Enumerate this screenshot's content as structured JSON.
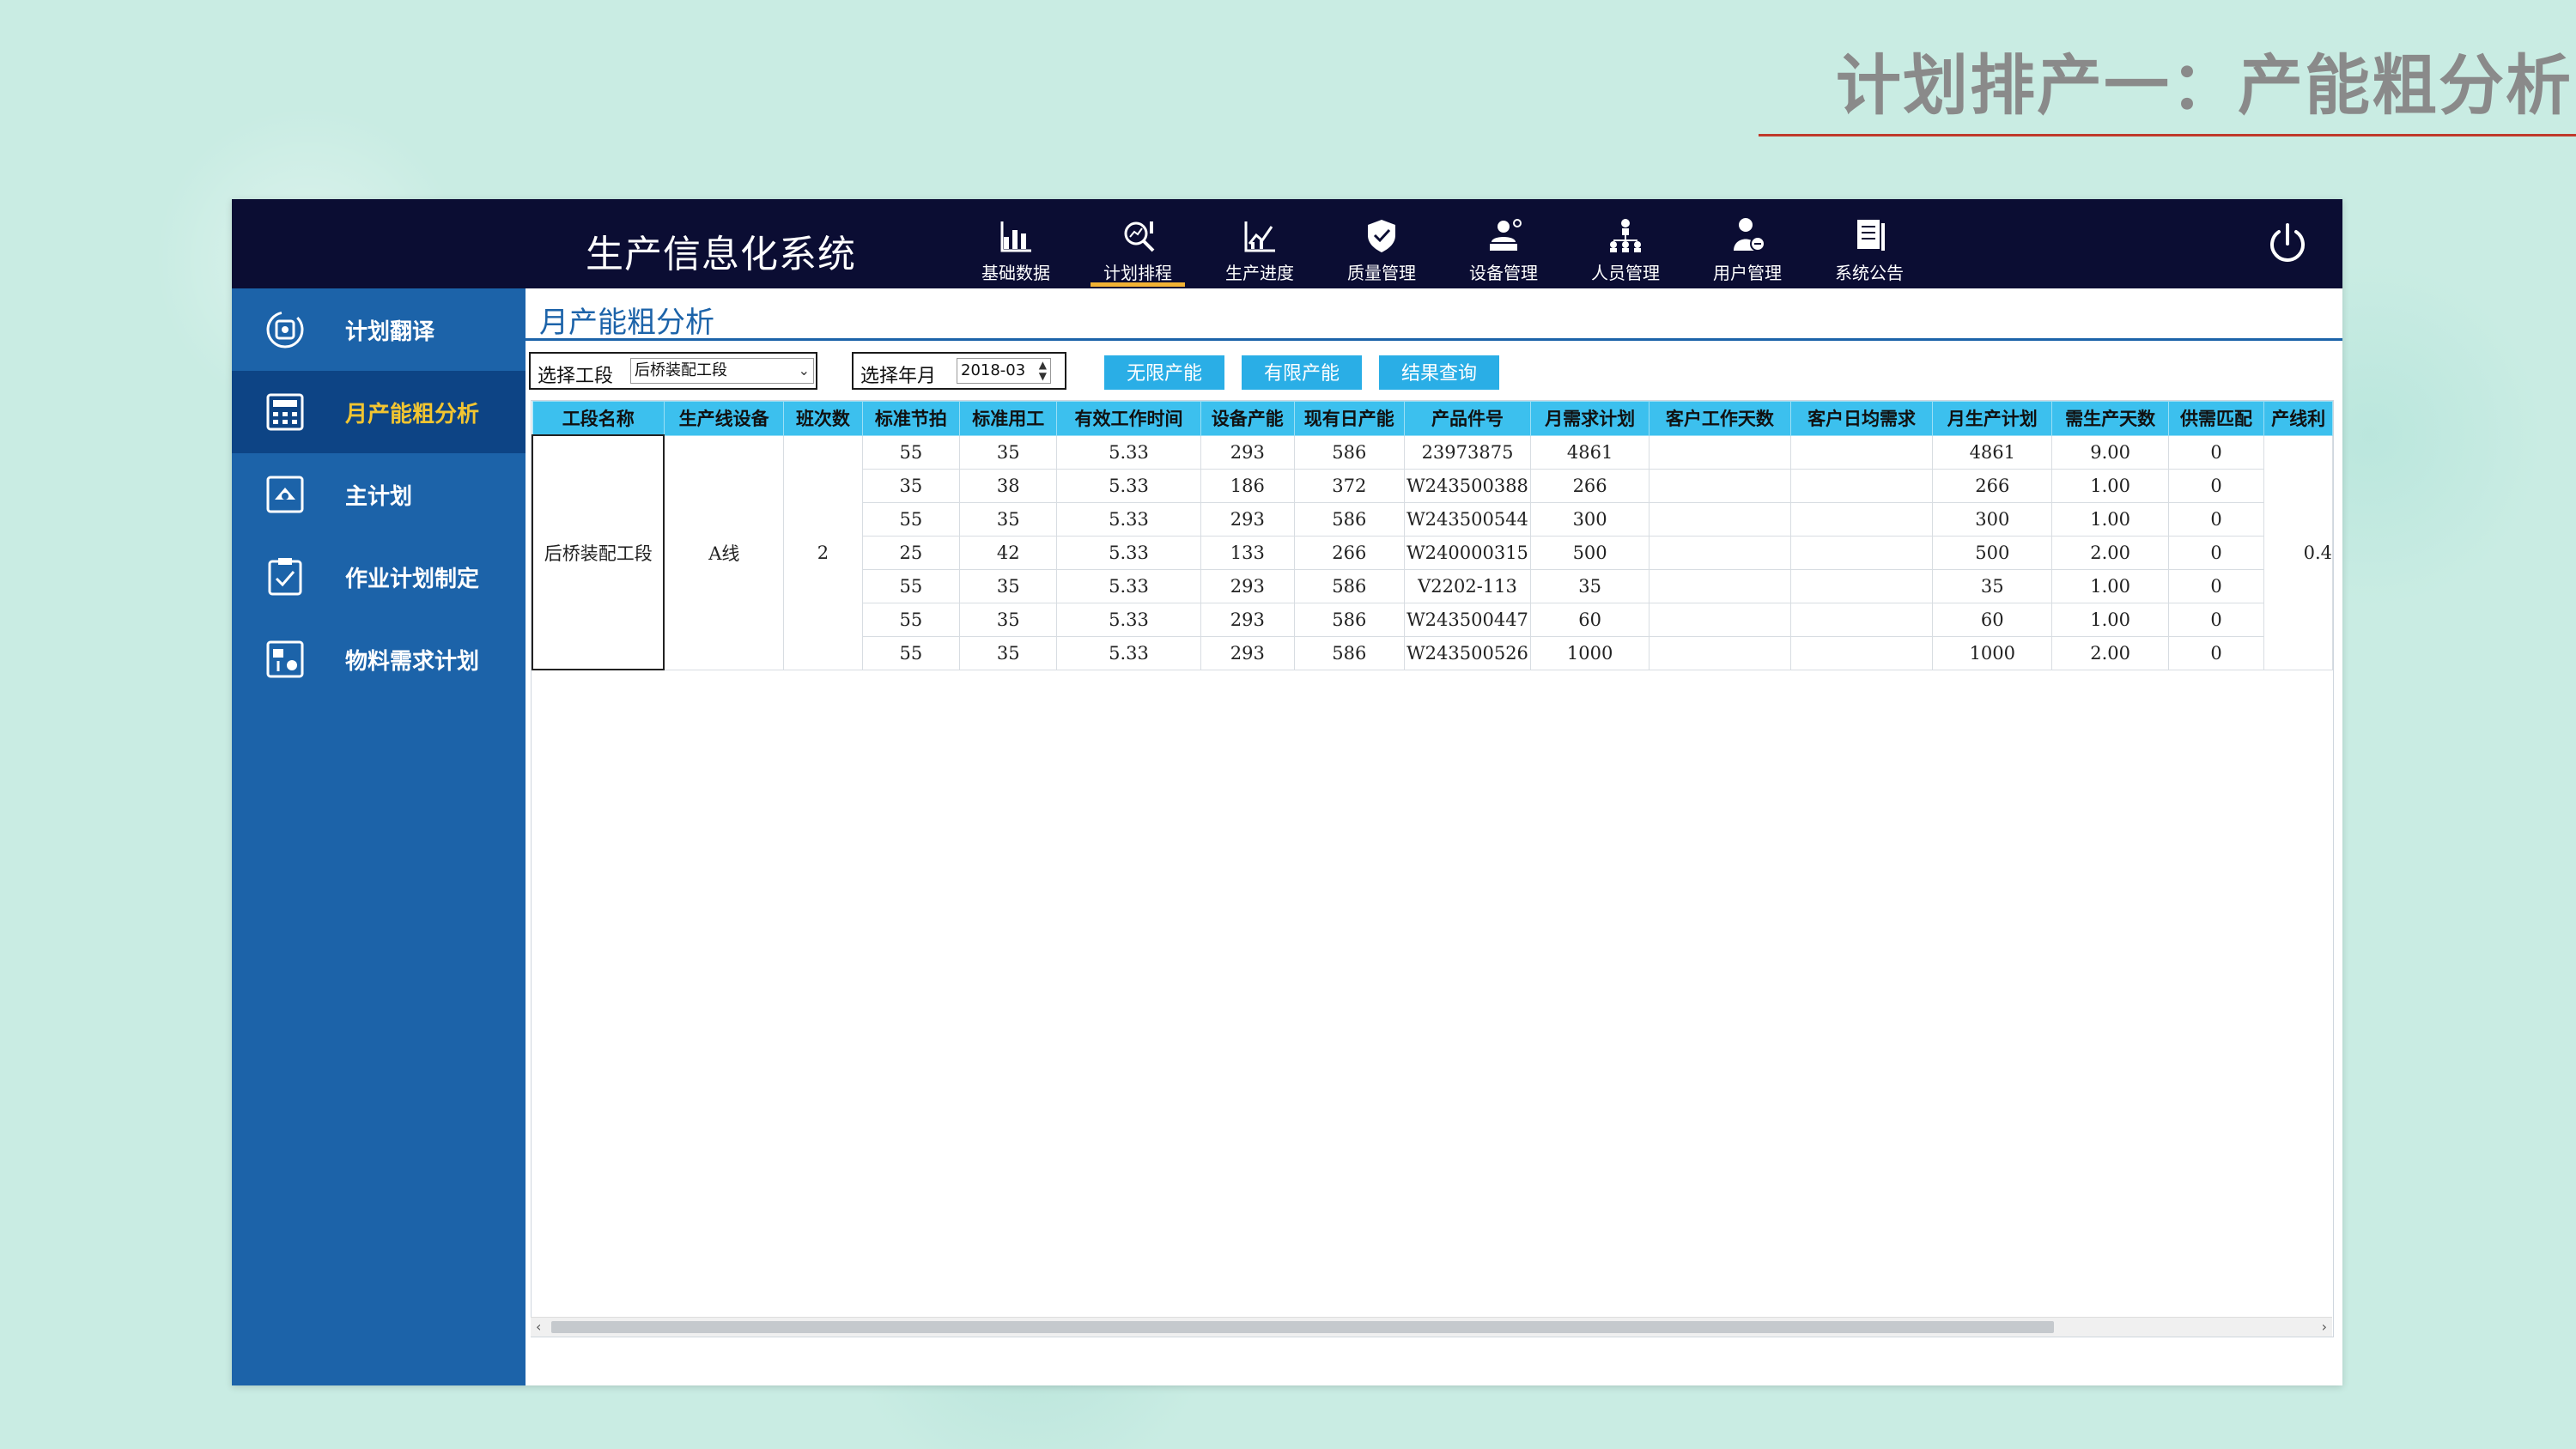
{
  "slide": {
    "title": "计划排产一：产能粗分析"
  },
  "topbar": {
    "system_title": "生产信息化系统",
    "nav": [
      {
        "label": "基础数据",
        "icon": "bar-chart-icon"
      },
      {
        "label": "计划排程",
        "icon": "search-analytics-icon",
        "active": true
      },
      {
        "label": "生产进度",
        "icon": "line-chart-icon"
      },
      {
        "label": "质量管理",
        "icon": "shield-check-icon"
      },
      {
        "label": "设备管理",
        "icon": "device-user-icon"
      },
      {
        "label": "人员管理",
        "icon": "org-chart-icon"
      },
      {
        "label": "用户管理",
        "icon": "user-icon"
      },
      {
        "label": "系统公告",
        "icon": "notice-icon"
      }
    ],
    "power_icon": "power-icon"
  },
  "sidebar": {
    "items": [
      {
        "label": "计划翻译",
        "icon": "translate-icon"
      },
      {
        "label": "月产能粗分析",
        "icon": "calculator-icon",
        "active": true
      },
      {
        "label": "主计划",
        "icon": "plan-icon"
      },
      {
        "label": "作业计划制定",
        "icon": "clipboard-check-icon"
      },
      {
        "label": "物料需求计划",
        "icon": "material-icon"
      }
    ]
  },
  "main": {
    "page_title": "月产能粗分析",
    "filters": {
      "section_label": "选择工段",
      "section_value": "后桥装配工段",
      "month_label": "选择年月",
      "month_value": "2018-03"
    },
    "buttons": {
      "unlimited": "无限产能",
      "limited": "有限产能",
      "query": "结果查询"
    },
    "table": {
      "columns": [
        "工段名称",
        "生产线设备",
        "班次数",
        "标准节拍",
        "标准用工",
        "有效工作时间",
        "设备产能",
        "现有日产能",
        "产品件号",
        "月需求计划",
        "客户工作天数",
        "客户日均需求",
        "月生产计划",
        "需生产天数",
        "供需匹配",
        "产线利"
      ],
      "merged": {
        "section_name": "后桥装配工段",
        "line": "A线",
        "shifts": "2",
        "extra": "0.4"
      },
      "rows": [
        [
          "55",
          "35",
          "5.33",
          "293",
          "586",
          "23973875",
          "4861",
          "",
          "",
          "4861",
          "9.00",
          "0"
        ],
        [
          "35",
          "38",
          "5.33",
          "186",
          "372",
          "W243500388",
          "266",
          "",
          "",
          "266",
          "1.00",
          "0"
        ],
        [
          "55",
          "35",
          "5.33",
          "293",
          "586",
          "W243500544",
          "300",
          "",
          "",
          "300",
          "1.00",
          "0"
        ],
        [
          "25",
          "42",
          "5.33",
          "133",
          "266",
          "W240000315",
          "500",
          "",
          "",
          "500",
          "2.00",
          "0"
        ],
        [
          "55",
          "35",
          "5.33",
          "293",
          "586",
          "V2202-113",
          "35",
          "",
          "",
          "35",
          "1.00",
          "0"
        ],
        [
          "55",
          "35",
          "5.33",
          "293",
          "586",
          "W243500447",
          "60",
          "",
          "",
          "60",
          "1.00",
          "0"
        ],
        [
          "55",
          "35",
          "5.33",
          "293",
          "586",
          "W243500526",
          "1000",
          "",
          "",
          "1000",
          "2.00",
          "0"
        ]
      ]
    }
  }
}
